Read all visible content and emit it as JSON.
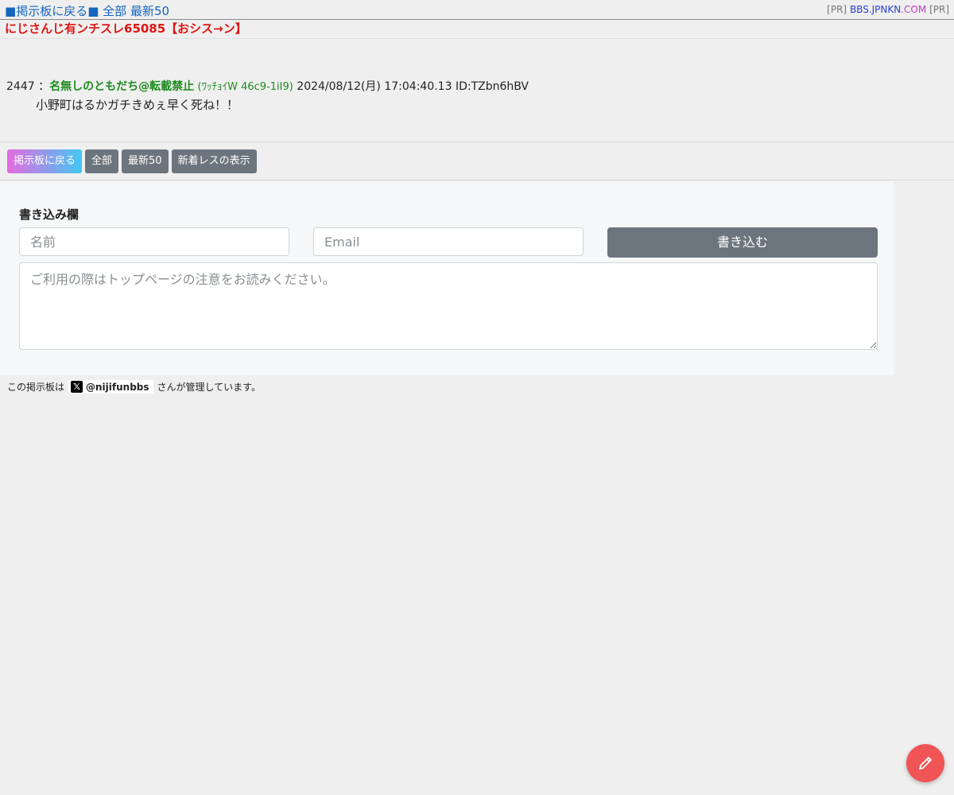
{
  "topnav": {
    "square": "■",
    "back_label": "掲示板に戻る",
    "all_label": "全部",
    "latest_label": "最新50"
  },
  "pr": {
    "left_tag": "[PR]",
    "link_part1": "BBS.JPNKN",
    "link_part2": ".COM",
    "right_tag": "[PR]"
  },
  "thread": {
    "title": "にじさんじ有ンチスレ65085【おシス→ン】"
  },
  "post": {
    "number": "2447 ：",
    "name": "名無しのともだち@転載禁止",
    "trip": "(ﾜｯﾁｮｲW 46c9-1iI9)",
    "date": "2024/08/12(月) 17:04:40.13",
    "id": "ID:TZbn6hBV",
    "body": "小野町はるかガチきめぇ早く死ね！！"
  },
  "buttons": {
    "back": "掲示板に戻る",
    "all": "全部",
    "latest": "最新50",
    "new_replies": "新着レスの表示"
  },
  "form": {
    "label": "書き込み欄",
    "name_placeholder": "名前",
    "email_placeholder": "Email",
    "submit": "書き込む",
    "message_placeholder": "ご利用の際はトップページの注意をお読みください。"
  },
  "footer": {
    "prefix": "この掲示板は",
    "handle": "@nijifunbbs",
    "suffix": "さんが管理しています。",
    "x_icon_glyph": "𝕏"
  },
  "fab": {
    "icon": "pencil-icon",
    "color": "#f05454"
  }
}
